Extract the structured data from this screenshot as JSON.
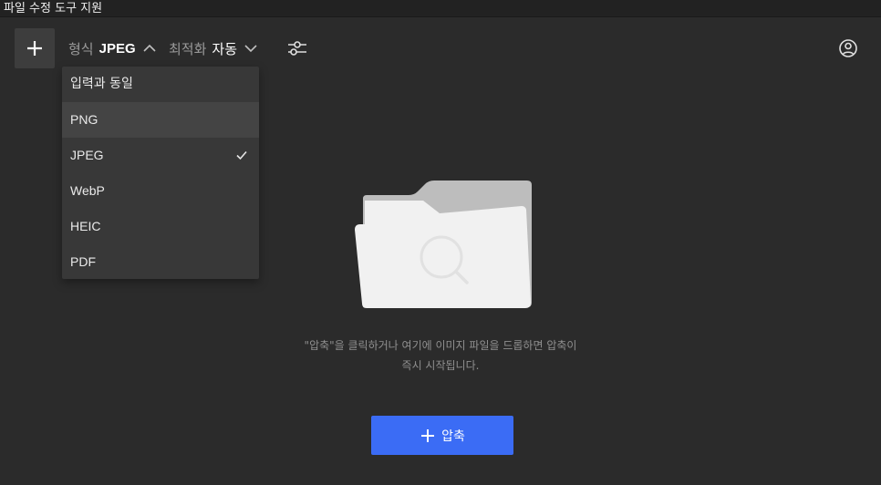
{
  "window": {
    "title": "파일 수정 도구 지원"
  },
  "toolbar": {
    "add_icon": "plus-icon",
    "format_label": "형식",
    "format_value": "JPEG",
    "optimize_label": "최적화",
    "optimize_value": "자동",
    "settings_icon": "sliders-icon",
    "account_icon": "user-circle-icon"
  },
  "format_menu": {
    "items": [
      {
        "label": "입력과 동일",
        "hovered": false,
        "selected": false
      },
      {
        "label": "PNG",
        "hovered": true,
        "selected": false
      },
      {
        "label": "JPEG",
        "hovered": false,
        "selected": true
      },
      {
        "label": "WebP",
        "hovered": false,
        "selected": false
      },
      {
        "label": "HEIC",
        "hovered": false,
        "selected": false
      },
      {
        "label": "PDF",
        "hovered": false,
        "selected": false
      }
    ]
  },
  "dropzone": {
    "illustration_icon": "folder-search-icon",
    "hint_line1": "\"압축\"을 클릭하거나 여기에 이미지 파일을 드롭하면 압축이",
    "hint_line2": "즉시 시작됩니다."
  },
  "compress_button": {
    "label": "압축",
    "icon": "plus-icon"
  },
  "colors": {
    "background": "#2b2b2b",
    "menu_bg": "#383838",
    "accent": "#3b6cf5"
  }
}
